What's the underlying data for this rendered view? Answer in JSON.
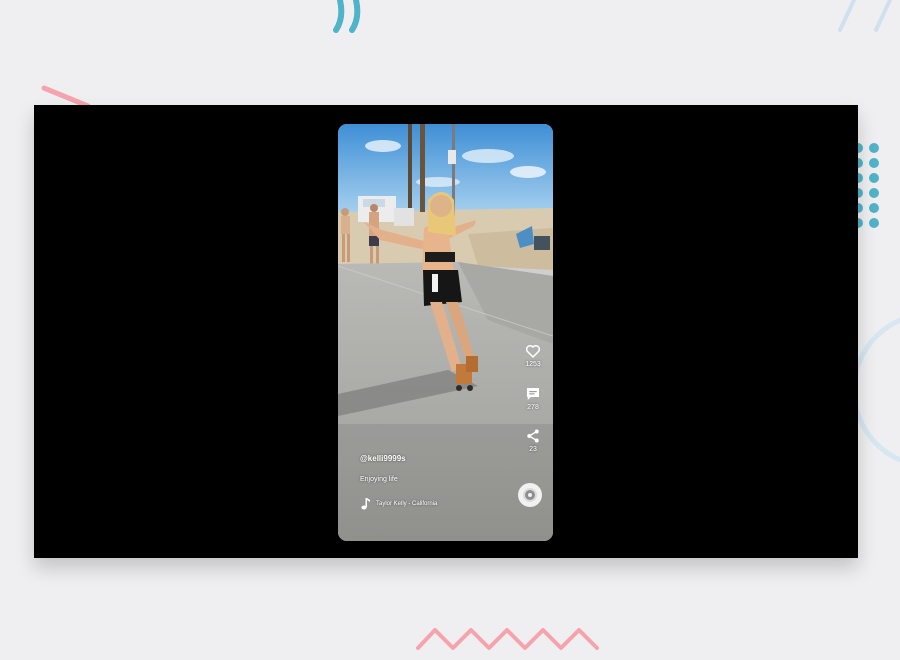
{
  "video": {
    "handle": "@kelli9999s",
    "caption": "Enjoying life",
    "music": "Taylor Kelly - California"
  },
  "actions": [
    {
      "icon": "heart-icon",
      "count": "1253"
    },
    {
      "icon": "comment-icon",
      "count": "278"
    },
    {
      "icon": "share-icon",
      "count": "23"
    }
  ],
  "colors": {
    "background": "#efeff1",
    "player": "#000000",
    "accent_blue": "#4fb3c9",
    "accent_pink": "#f5a3ad"
  }
}
